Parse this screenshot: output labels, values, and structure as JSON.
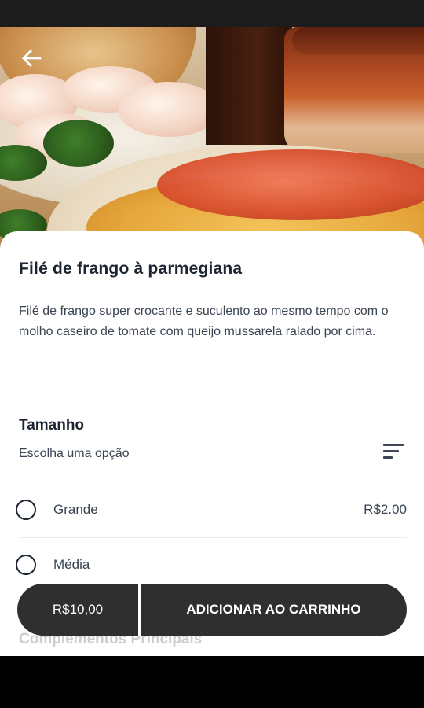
{
  "product": {
    "title": "Filé de frango à parmegiana",
    "description": "Filé de frango super crocante e suculento ao mesmo tempo com o molho caseiro de tomate com queijo mussarela ralado por cima.",
    "image_alt": "filé de frango à parmegiana com arroz"
  },
  "size_section": {
    "title": "Tamanho",
    "subtitle": "Escolha uma opção",
    "options": [
      {
        "label": "Grande",
        "price": "R$2.00"
      },
      {
        "label": "Média",
        "price": ""
      }
    ]
  },
  "next_section": {
    "title": "Complementos Principais"
  },
  "cart_bar": {
    "total": "R$10,00",
    "add_label": "ADICIONAR AO CARRINHO"
  },
  "icons": {
    "back": "arrow-left",
    "filter": "sort-lines",
    "radio": "radio-unchecked"
  },
  "colors": {
    "dark_button": "#2f2f2f",
    "title_text": "#1b2430",
    "body_text": "#3a4452"
  }
}
